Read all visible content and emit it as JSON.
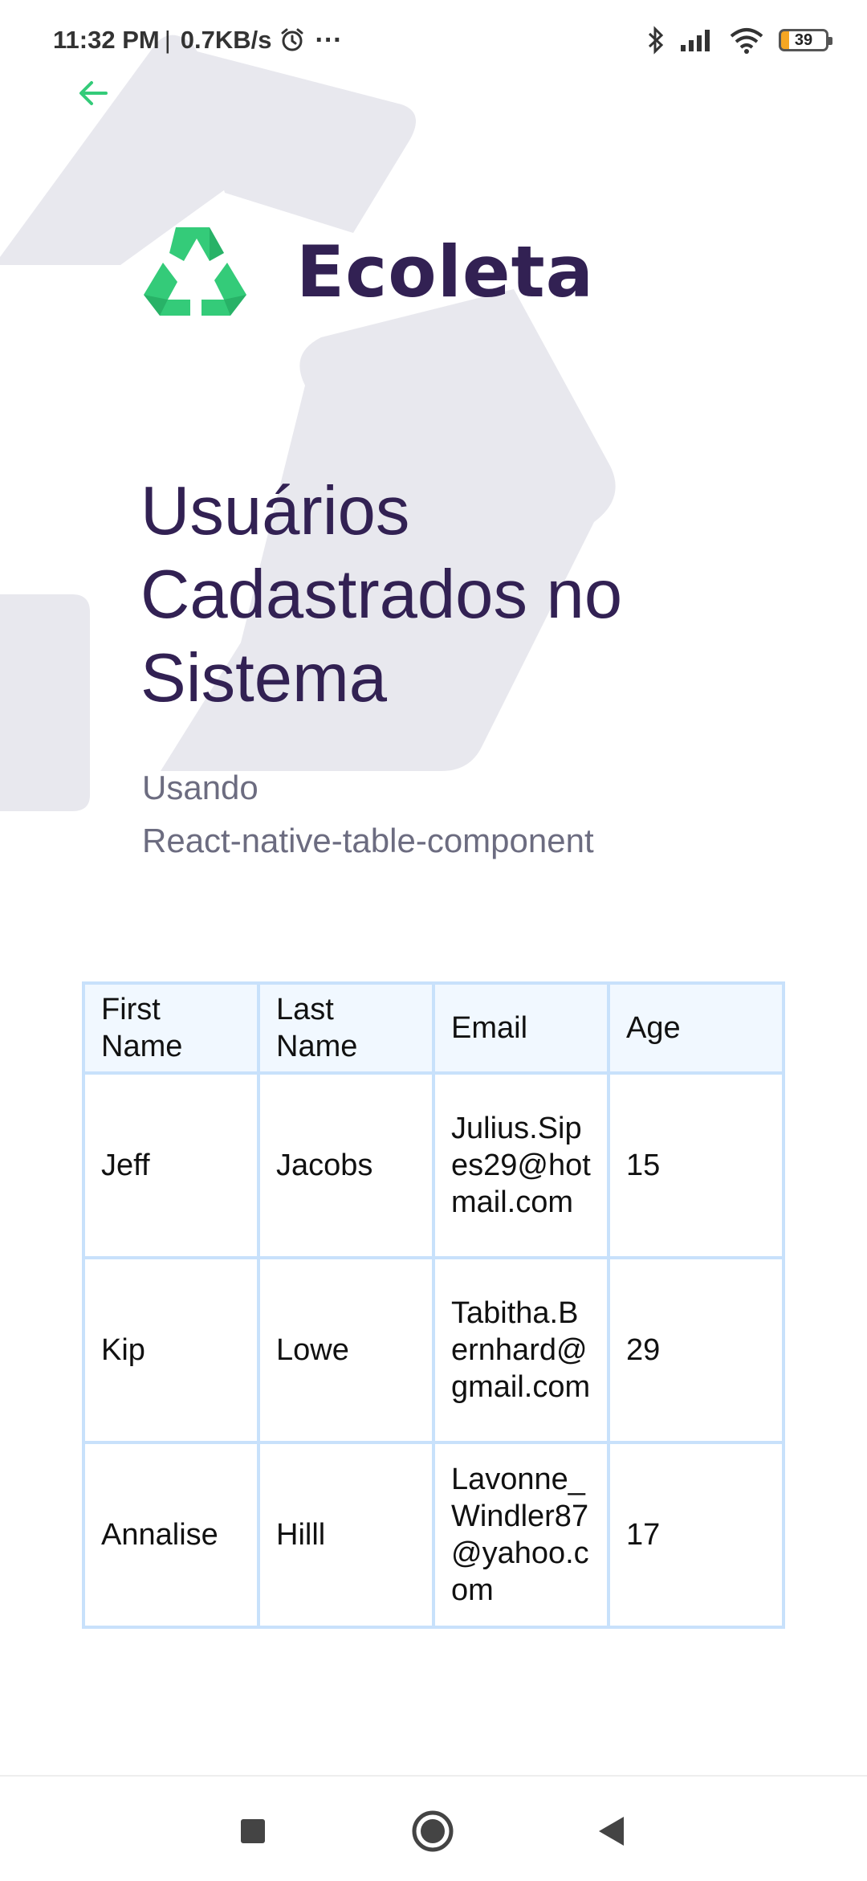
{
  "status_bar": {
    "time": "11:32 PM",
    "separator": "|",
    "network_speed": "0.7KB/s",
    "more": "···",
    "battery_level": "39",
    "icons": [
      "alarm-icon",
      "bluetooth-icon",
      "signal-icon",
      "wifi-icon",
      "battery-icon"
    ]
  },
  "header": {
    "back_icon": "arrow-left-icon",
    "brand": "Ecoleta",
    "logo_icon": "recycle-icon"
  },
  "main": {
    "title": "Usuários Cadastrados no Sistema",
    "subtitle_line1": "Usando",
    "subtitle_line2": "React-native-table-component"
  },
  "table": {
    "headers": [
      "First Name",
      "Last Name",
      "Email",
      "Age"
    ],
    "rows": [
      [
        "Jeff",
        "Jacobs",
        "Julius.Sipes29@hotmail.com",
        "15"
      ],
      [
        "Kip",
        "Lowe",
        "Tabitha.Bernhard@gmail.com",
        "29"
      ],
      [
        "Annalise",
        "Hilll",
        "Lavonne_Windler87@yahoo.com",
        "17"
      ]
    ]
  },
  "nav_bar": {
    "icons": [
      "recent-apps-icon",
      "home-icon",
      "back-icon"
    ]
  },
  "colors": {
    "brand_green": "#34cb79",
    "brand_dark": "#322153",
    "text_muted": "#6c6c80",
    "table_border": "#c8e1fb",
    "table_header_bg": "#f1f8ff"
  }
}
